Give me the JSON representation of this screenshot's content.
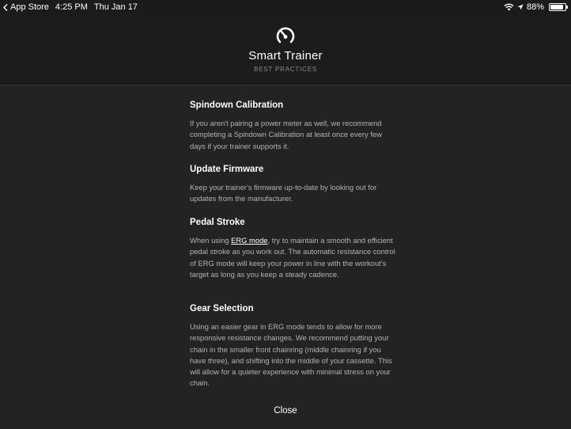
{
  "status_bar": {
    "back_app": "App Store",
    "time": "4:25 PM",
    "date": "Thu Jan 17",
    "battery_percent": "88%",
    "battery_level": 0.88,
    "icons": [
      "back-arrow-icon",
      "wifi-icon",
      "location-arrow-icon",
      "battery-icon"
    ]
  },
  "header": {
    "logo_icon": "trainer-gauge-icon",
    "title": "Smart Trainer",
    "subtitle": "BEST PRACTICES"
  },
  "sections": [
    {
      "title": "Spindown Calibration",
      "body": "If you aren't pairing a power meter as well, we recommend completing a Spindown Calibration at least once every few days if your trainer supports it."
    },
    {
      "title": "Update Firmware",
      "body": "Keep your trainer's firmware up-to-date by looking out for updates from the manufacturer."
    },
    {
      "title": "Pedal Stroke",
      "body_before_link": "When using ",
      "link_text": "ERG mode",
      "body_after_link": ", try to maintain a smooth and efficient pedal stroke as you work out. The automatic resistance control of ERG mode will keep your power in line with the workout's target as long as you keep a steady cadence."
    },
    {
      "title": "Gear Selection",
      "body": "Using an easier gear in ERG mode tends to allow for more responsive resistance changes. We recommend putting your chain in the smaller front chainring (middle chainring if you have three), and shifting into the middle of your cassette. This will allow for a quieter experience with minimal stress on your chain."
    }
  ],
  "close_label": "Close",
  "colors": {
    "background": "#232323",
    "header_background": "#1c1c1c",
    "body_text": "#b3b3b3",
    "heading_text": "#ffffff"
  }
}
